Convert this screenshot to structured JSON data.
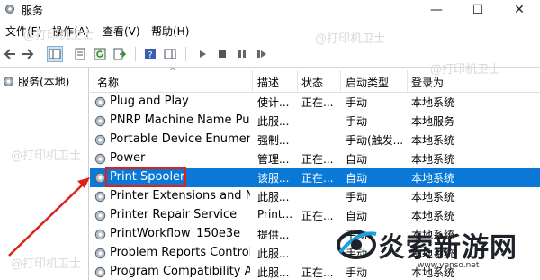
{
  "window": {
    "title": "服务",
    "min": "—",
    "max": "☐",
    "close": "✕"
  },
  "menu": {
    "items": [
      "文件(F)",
      "操作(A)",
      "查看(V)",
      "帮助(H)"
    ]
  },
  "tree": {
    "root": "服务(本地)"
  },
  "columns": [
    "名称",
    "描述",
    "状态",
    "启动类型",
    "登录为"
  ],
  "rows": [
    {
      "name": "Plug and Play",
      "desc": "使计...",
      "status": "正在...",
      "start": "手动",
      "logon": "本地系统"
    },
    {
      "name": "PNRP Machine Name Pu...",
      "desc": "此服...",
      "status": "",
      "start": "手动",
      "logon": "本地服务"
    },
    {
      "name": "Portable Device Enumera...",
      "desc": "强制...",
      "status": "",
      "start": "手动(触发...",
      "logon": "本地系统"
    },
    {
      "name": "Power",
      "desc": "管理...",
      "status": "正在...",
      "start": "自动",
      "logon": "本地系统"
    },
    {
      "name": "Print Spooler",
      "desc": "该服...",
      "status": "正在...",
      "start": "自动",
      "logon": "本地系统"
    },
    {
      "name": "Printer Extensions and N...",
      "desc": "此服...",
      "status": "",
      "start": "手动",
      "logon": "本地系统"
    },
    {
      "name": "Printer Repair Service",
      "desc": "Print...",
      "status": "正在...",
      "start": "自动",
      "logon": "本地系统"
    },
    {
      "name": "PrintWorkflow_150e3e",
      "desc": "提供...",
      "status": "",
      "start": "手动",
      "logon": "本地系统"
    },
    {
      "name": "Problem Reports Control...",
      "desc": "此服...",
      "status": "",
      "start": "手动",
      "logon": "本地系统"
    },
    {
      "name": "Program Compatibility A...",
      "desc": "此服...",
      "status": "正在...",
      "start": "手动",
      "logon": "本地系统"
    }
  ],
  "selected_row": "Print Spooler",
  "watermarks": {
    "text": "@打印机卫士",
    "logo_text": "炎索新游网",
    "logo_url": "www.yenso.net"
  },
  "colors": {
    "selection": "#0a78d7",
    "highlight": "#e0201a",
    "arrow": "#e0201a"
  }
}
